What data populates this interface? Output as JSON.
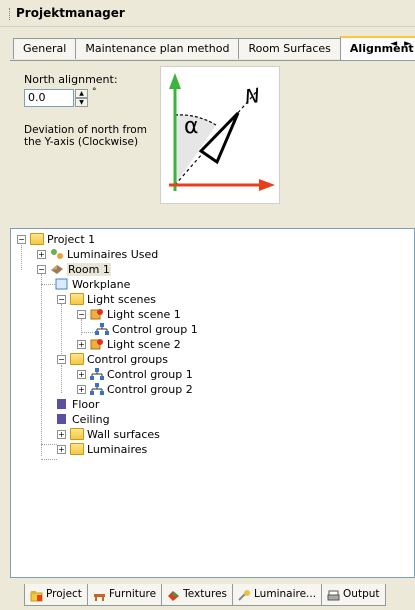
{
  "window": {
    "title": "Projektmanager"
  },
  "tabs": [
    {
      "label": "General",
      "active": false
    },
    {
      "label": "Maintenance plan method",
      "active": false
    },
    {
      "label": "Room Surfaces",
      "active": false
    },
    {
      "label": "Alignment",
      "active": true
    }
  ],
  "tab_scroll": {
    "arrows": "◄ ►"
  },
  "alignment": {
    "north_label": "North alignment:",
    "north_value": "0.0",
    "unit": "°",
    "description": "Deviation of north from the Y-axis (Clockwise)",
    "diagram_labels": {
      "alpha": "α",
      "north": "N"
    }
  },
  "tree": {
    "nodes": [
      {
        "label": "Project 1",
        "icon": "folder-icon"
      },
      {
        "label": "Luminaires Used",
        "icon": "luminaires-used-icon"
      },
      {
        "label": "Room 1",
        "icon": "room-icon",
        "selected": true
      },
      {
        "label": "Workplane",
        "icon": "workplane-icon"
      },
      {
        "label": "Light scenes",
        "icon": "folder-icon"
      },
      {
        "label": "Light scene 1",
        "icon": "light-scene-icon"
      },
      {
        "label": "Control group 1",
        "icon": "control-group-icon"
      },
      {
        "label": "Light scene 2",
        "icon": "light-scene-icon"
      },
      {
        "label": "Control groups",
        "icon": "folder-icon"
      },
      {
        "label": "Control group 1",
        "icon": "control-group-icon"
      },
      {
        "label": "Control group 2",
        "icon": "control-group-icon"
      },
      {
        "label": "Floor",
        "icon": "floor-icon"
      },
      {
        "label": "Ceiling",
        "icon": "ceiling-icon"
      },
      {
        "label": "Wall surfaces",
        "icon": "folder-icon"
      },
      {
        "label": "Luminaires",
        "icon": "folder-icon"
      }
    ]
  },
  "bottom_tabs": [
    {
      "label": "Project",
      "icon": "project-icon",
      "active": true
    },
    {
      "label": "Furniture",
      "icon": "furniture-icon"
    },
    {
      "label": "Textures",
      "icon": "textures-icon"
    },
    {
      "label": "Luminaire...",
      "icon": "luminaire-icon"
    },
    {
      "label": "Output",
      "icon": "output-icon"
    }
  ],
  "colors": {
    "axis_green": "#3cb43c",
    "axis_red": "#e8401c",
    "tab_highlight": "#ffc83c"
  }
}
